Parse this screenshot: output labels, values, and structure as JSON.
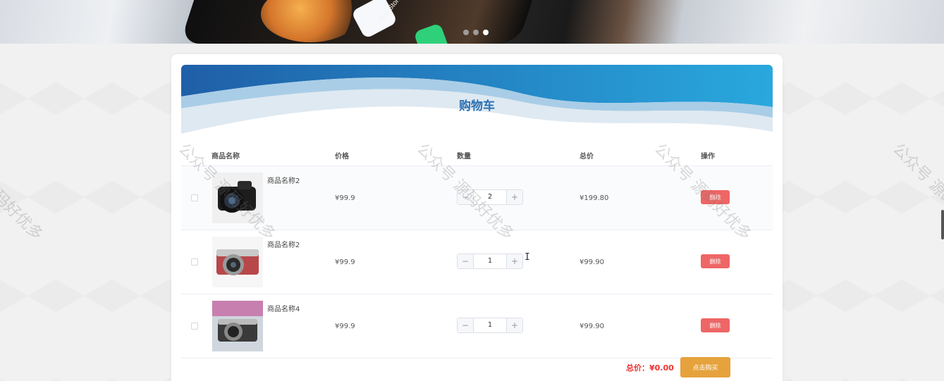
{
  "banner": {
    "app_label": "App Store",
    "carousel_dots": 3,
    "active_dot": 3
  },
  "cart": {
    "title": "购物车",
    "columns": [
      "商品名称",
      "价格",
      "数量",
      "总价",
      "操作"
    ],
    "items": [
      {
        "name": "商品名称2",
        "price": "¥99.9",
        "quantity": "2",
        "total": "¥199.80",
        "action": "删除"
      },
      {
        "name": "商品名称2",
        "price": "¥99.9",
        "quantity": "1",
        "total": "¥99.90",
        "action": "删除"
      },
      {
        "name": "商品名称4",
        "price": "¥99.9",
        "quantity": "1",
        "total": "¥99.90",
        "action": "删除"
      }
    ],
    "stepper_minus": "−",
    "stepper_plus": "+",
    "summary_label": "总价：",
    "summary_value": "¥0.00",
    "buy_label": "点击购买"
  },
  "watermark": "公众号 源码好优多",
  "colors": {
    "title": "#2c72b3",
    "delete_button": "#ee6666",
    "buy_button": "#e6a23c",
    "total_text": "#ee3333",
    "wave_dark": "#1f5fa8",
    "wave_light": "#29a8de"
  }
}
